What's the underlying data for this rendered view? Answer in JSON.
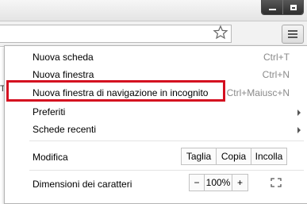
{
  "menu": {
    "new_tab": {
      "label": "Nuova scheda",
      "shortcut": "Ctrl+T"
    },
    "new_window": {
      "label": "Nuova finestra",
      "shortcut": "Ctrl+N"
    },
    "incognito": {
      "label": "Nuova finestra di navigazione in incognito",
      "shortcut": "Ctrl+Maiusc+N"
    },
    "bookmarks": {
      "label": "Preferiti"
    },
    "recent_tabs": {
      "label": "Schede recenti"
    },
    "edit": {
      "label": "Modifica",
      "cut": "Taglia",
      "copy": "Copia",
      "paste": "Incolla"
    },
    "zoom": {
      "label": "Dimensioni dei caratteri",
      "minus": "−",
      "value": "100%",
      "plus": "+"
    }
  },
  "page": {
    "left_char": "T"
  },
  "colors": {
    "highlight": "#d40f20",
    "shortcut": "#8a8a8a"
  },
  "icons": [
    "minimize-icon",
    "maximize-icon",
    "star-icon",
    "menu-icon",
    "submenu-arrow-icon",
    "fullscreen-icon"
  ]
}
